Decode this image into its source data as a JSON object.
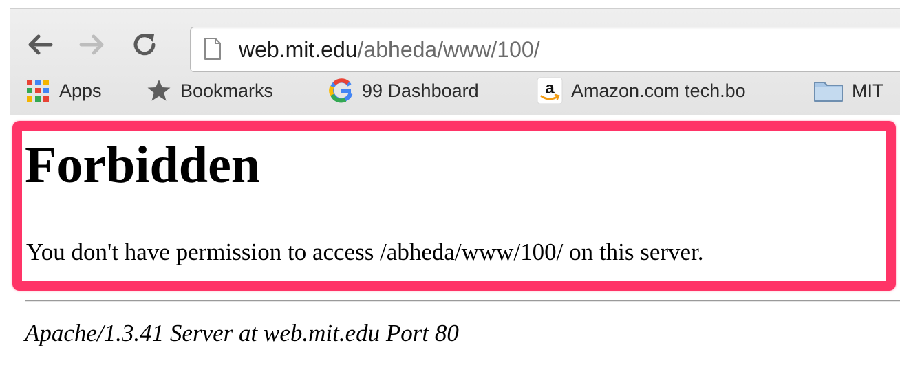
{
  "browser": {
    "url_host": "web.mit.edu",
    "url_path": "/abheda/www/100/",
    "nav_icons": [
      "back-arrow-icon",
      "forward-arrow-icon",
      "reload-icon"
    ],
    "bookmarks": [
      {
        "label": "Apps",
        "icon": "apps-grid-icon"
      },
      {
        "label": "Bookmarks",
        "icon": "star-icon"
      },
      {
        "label": "99 Dashboard",
        "icon": "google-g-icon"
      },
      {
        "label": "Amazon.com tech.bo",
        "icon": "amazon-icon"
      },
      {
        "label": "MIT",
        "icon": "folder-icon"
      }
    ]
  },
  "page": {
    "title": "Forbidden",
    "message": "You don't have permission to access /abheda/www/100/ on this server.",
    "signature": "Apache/1.3.41 Server at web.mit.edu Port 80"
  },
  "colors": {
    "highlight": "#ff3467",
    "toolbar_bg": "#e9e9e9",
    "url_host": "#1b1b1b",
    "url_path": "#6b6b6b"
  }
}
